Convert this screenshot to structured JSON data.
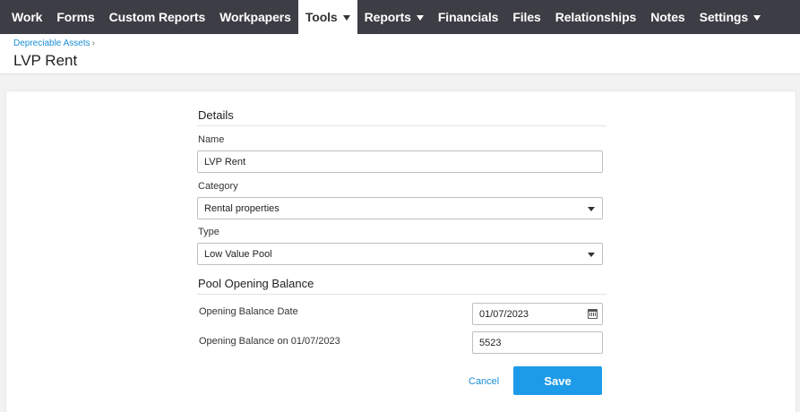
{
  "nav": {
    "items": [
      {
        "label": "Work"
      },
      {
        "label": "Forms"
      },
      {
        "label": "Custom Reports"
      },
      {
        "label": "Workpapers"
      },
      {
        "label": "Tools",
        "active": true,
        "dropdown": true
      },
      {
        "label": "Reports",
        "dropdown": true
      },
      {
        "label": "Financials"
      },
      {
        "label": "Files"
      },
      {
        "label": "Relationships"
      },
      {
        "label": "Notes"
      },
      {
        "label": "Settings",
        "dropdown": true
      }
    ]
  },
  "breadcrumb": {
    "link": "Depreciable Assets",
    "separator": "›"
  },
  "page": {
    "title": "LVP Rent"
  },
  "details": {
    "heading": "Details",
    "name_label": "Name",
    "name_value": "LVP Rent",
    "category_label": "Category",
    "category_value": "Rental properties",
    "type_label": "Type",
    "type_value": "Low Value Pool"
  },
  "pool": {
    "heading": "Pool Opening Balance",
    "date_label": "Opening Balance Date",
    "date_value": "01/07/2023",
    "balance_label": "Opening Balance on 01/07/2023",
    "balance_value": "5523"
  },
  "actions": {
    "cancel_label": "Cancel",
    "save_label": "Save"
  },
  "icons": {
    "dropdown": "chevron-down-icon",
    "date": "calendar-icon"
  },
  "colors": {
    "nav_bg": "#3d3d45",
    "accent": "#1e9be8",
    "link": "#1a8fd6"
  }
}
